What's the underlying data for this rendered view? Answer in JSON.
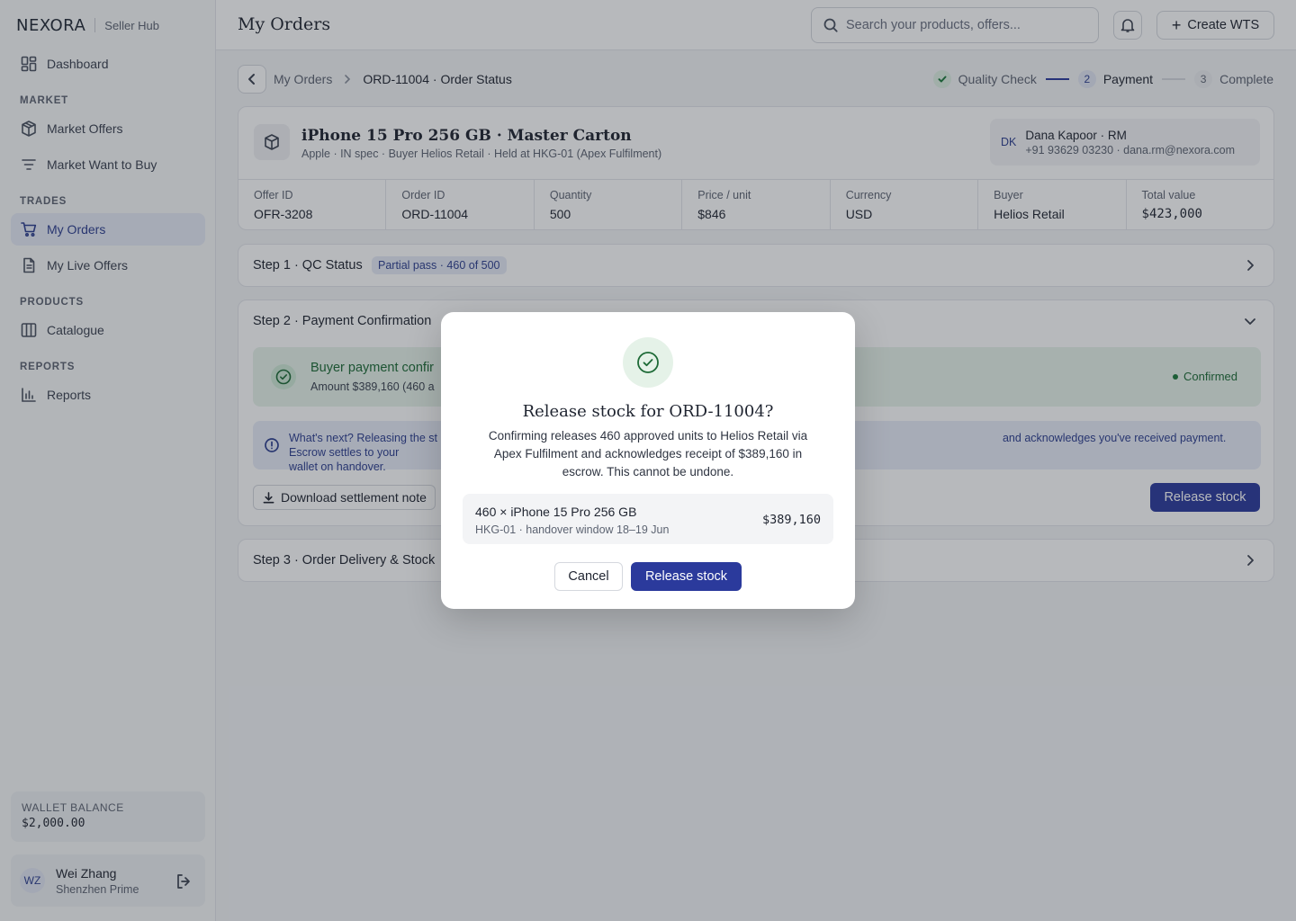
{
  "brand": {
    "name": "NEXORA",
    "sub": "Seller Hub"
  },
  "sidebar": {
    "dashboard": "Dashboard",
    "sections": {
      "market": "MARKET",
      "trades": "TRADES",
      "products": "PRODUCTS",
      "reports": "REPORTS"
    },
    "items": {
      "market_offers": "Market Offers",
      "market_wtb": "Market Want to Buy",
      "my_orders": "My Orders",
      "my_live_offers": "My Live Offers",
      "catalogue": "Catalogue",
      "reports": "Reports"
    },
    "active": "my_orders",
    "wallet": {
      "label": "WALLET BALANCE",
      "value": "$2,000.00"
    },
    "user": {
      "initials": "WZ",
      "name": "Wei Zhang",
      "org": "Shenzhen Prime"
    }
  },
  "header": {
    "title": "My Orders",
    "search_placeholder": "Search your products, offers...",
    "create_label": "Create WTS"
  },
  "breadcrumb": {
    "parent": "My Orders",
    "current": "ORD-11004 · Order Status"
  },
  "stepper": [
    {
      "badge": "",
      "label": "Quality Check",
      "state": "done"
    },
    {
      "badge": "2",
      "label": "Payment",
      "state": "current"
    },
    {
      "badge": "3",
      "label": "Complete",
      "state": "todo"
    }
  ],
  "product": {
    "title": "iPhone 15 Pro 256 GB · Master Carton",
    "subtitle": "Apple · IN spec · Buyer Helios Retail · Held at HKG-01 (Apex Fulfilment)",
    "rm": {
      "initials": "DK",
      "name": "Dana Kapoor · RM",
      "contact": "+91 93629 03230 · dana.rm@nexora.com"
    },
    "meta": [
      {
        "label": "Offer ID",
        "value": "OFR-3208"
      },
      {
        "label": "Order ID",
        "value": "ORD-11004"
      },
      {
        "label": "Quantity",
        "value": "500"
      },
      {
        "label": "Price / unit",
        "value": "$846"
      },
      {
        "label": "Currency",
        "value": "USD"
      },
      {
        "label": "Buyer",
        "value": "Helios Retail"
      },
      {
        "label": "Total value",
        "value": "$423,000"
      }
    ]
  },
  "step1": {
    "title": "Step 1 · QC Status",
    "pill": "Partial pass · 460 of 500"
  },
  "step2": {
    "title": "Step 2 · Payment Confirmation",
    "pay_title": "Buyer payment confir",
    "pay_sub": "Amount $389,160 (460 a",
    "status": "Confirmed",
    "info": "What's next? Releasing the st                                                                                                                      and acknowledges you've received payment. Escrow settles to your wallet on handover.",
    "info_line1_a": "What's next? Releasing the st",
    "info_line1_b": "and acknowledges you've received payment. Escrow settles to your",
    "info_line2": "wallet on handover.",
    "download_label": "Download settlement note",
    "release_label": "Release stock"
  },
  "step3": {
    "title": "Step 3 · Order Delivery & Stock"
  },
  "modal": {
    "title": "Release stock for ORD-11004?",
    "body": "Confirming releases 460 approved units to Helios Retail via Apex Fulfilment and acknowledges receipt of $389,160 in escrow. This cannot be undone.",
    "summary_title": "460 × iPhone 15 Pro 256 GB",
    "summary_sub": "HKG-01 · handover window 18–19 Jun",
    "summary_amount": "$389,160",
    "cancel_label": "Cancel",
    "confirm_label": "Release stock"
  },
  "colors": {
    "accent": "#2b3a9c",
    "success": "#1d7a3c",
    "overlay": "rgba(30,36,48,0.32)"
  }
}
